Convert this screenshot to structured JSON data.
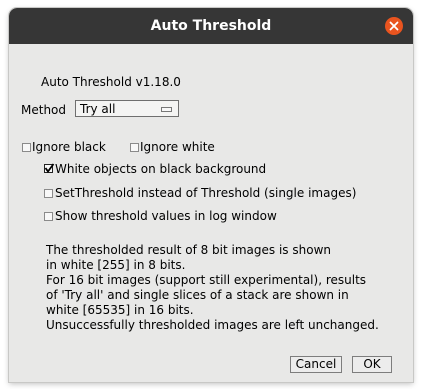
{
  "window": {
    "title": "Auto Threshold"
  },
  "header": {
    "version_text": "Auto Threshold v1.18.0"
  },
  "method": {
    "label": "Method",
    "selected": "Try all"
  },
  "options": {
    "ignore_black": {
      "label": "Ignore black",
      "checked": false
    },
    "ignore_white": {
      "label": "Ignore white",
      "checked": false
    },
    "white_objects": {
      "label": "White objects on black background",
      "checked": true
    },
    "set_threshold": {
      "label": "SetThreshold instead of Threshold (single images)",
      "checked": false
    },
    "show_values": {
      "label": "Show threshold values in log window",
      "checked": false
    }
  },
  "info_lines": [
    "The thresholded result of 8 bit images is shown",
    "in white [255] in 8 bits.",
    "For 16 bit images (support still experimental), results",
    "of 'Try all' and single slices of a stack are shown in",
    "white [65535] in 16 bits.",
    "Unsuccessfully thresholded images are left unchanged."
  ],
  "buttons": {
    "cancel": "Cancel",
    "ok": "OK"
  },
  "colors": {
    "titlebar": "#363636",
    "close": "#e9541f",
    "dialog_bg": "#e8e8e7"
  },
  "icons": {
    "close": "close-icon",
    "dropdown": "dropdown-icon",
    "check": "check-icon"
  }
}
